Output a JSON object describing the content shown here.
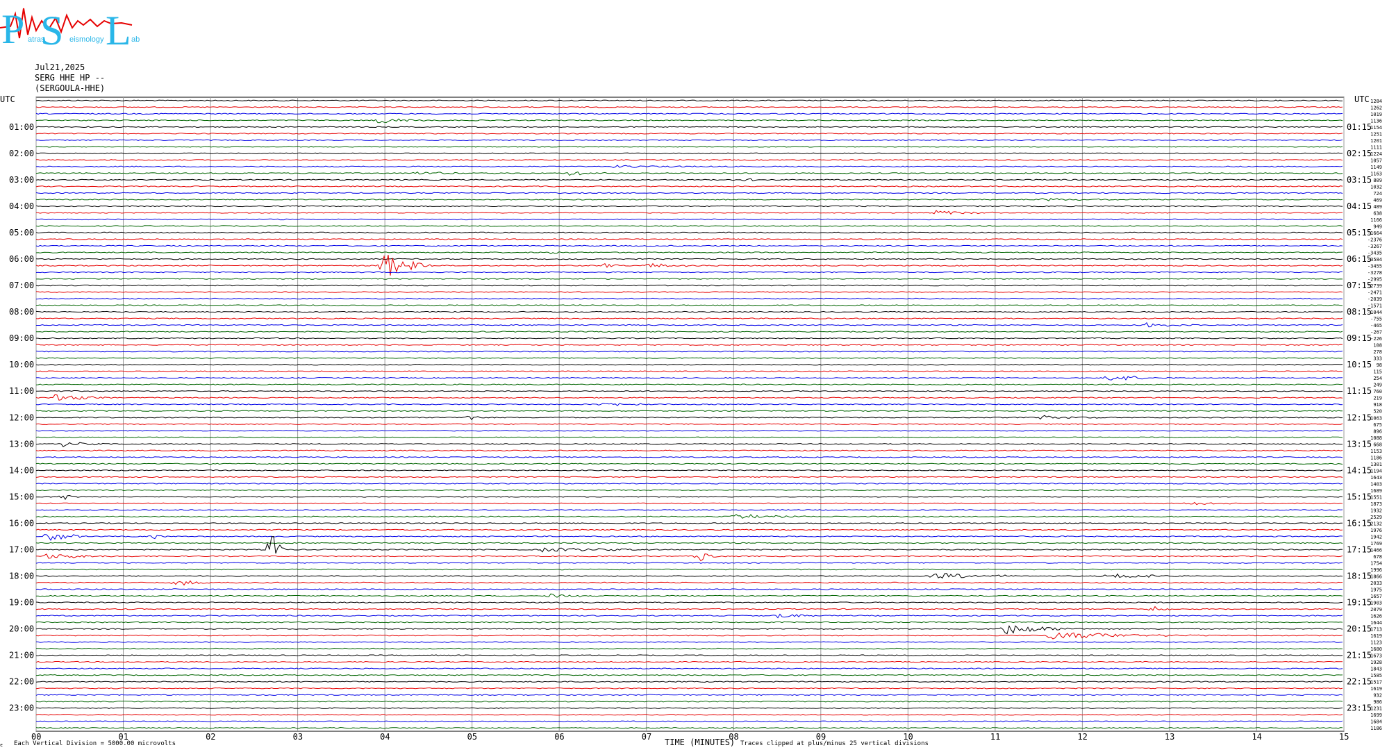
{
  "logo": {
    "letters": [
      "P",
      "S",
      "L"
    ],
    "subtext": [
      "atras",
      "eismology",
      "ab"
    ]
  },
  "header": {
    "date": "Jul21,2025",
    "station": "SERG HHE HP --",
    "channel": "(SERGOULA-HHE)"
  },
  "left_axis_label": "UTC",
  "right_axis_label": "UTC",
  "colors": {
    "black": "#000000",
    "red": "#e60000",
    "blue": "#0000e6",
    "green": "#006400",
    "grid": "#999999"
  },
  "footer": {
    "division": "Each Vertical Division = 5000.00 microvolts",
    "xlabel": "TIME (MINUTES)",
    "clip_note": "Traces clipped at plus/minus 25 vertical divisions",
    "corner_mark": "ϵ"
  },
  "chart_data": {
    "type": "helicorder",
    "x_ticks": [
      "00",
      "01",
      "02",
      "03",
      "04",
      "05",
      "06",
      "07",
      "08",
      "09",
      "10",
      "11",
      "12",
      "13",
      "14",
      "15"
    ],
    "xlim": [
      0,
      15
    ],
    "trace_colors": [
      "black",
      "red",
      "blue",
      "green"
    ],
    "left_hour_labels": [
      "01:00",
      "02:00",
      "03:00",
      "04:00",
      "05:00",
      "06:00",
      "07:00",
      "08:00",
      "09:00",
      "10:00",
      "11:00",
      "12:00",
      "13:00",
      "14:00",
      "15:00",
      "16:00",
      "17:00",
      "18:00",
      "19:00",
      "20:00",
      "21:00",
      "22:00",
      "23:00"
    ],
    "right_hour_labels": [
      "01:15",
      "02:15",
      "03:15",
      "04:15",
      "05:15",
      "06:15",
      "07:15",
      "08:15",
      "09:15",
      "10:15",
      "11:15",
      "12:15",
      "13:15",
      "14:15",
      "15:15",
      "16:15",
      "17:15",
      "18:15",
      "19:15",
      "20:15",
      "21:15",
      "22:15",
      "23:15"
    ],
    "trace_offsets": [
      1284,
      1262,
      1019,
      1136,
      1154,
      1251,
      1201,
      1111,
      1224,
      1057,
      1149,
      1163,
      809,
      1032,
      724,
      469,
      489,
      638,
      1166,
      949,
      -1664,
      -2376,
      -3267,
      -3435,
      -3584,
      -3455,
      -3278,
      -2995,
      -2739,
      -2471,
      -2039,
      -1571,
      -1044,
      -755,
      -465,
      -267,
      -226,
      108,
      278,
      333,
      98,
      115,
      254,
      249,
      760,
      219,
      918,
      520,
      1063,
      675,
      896,
      1088,
      668,
      1153,
      1186,
      1301,
      1194,
      1643,
      1403,
      1689,
      1551,
      1873,
      1932,
      2529,
      2132,
      1976,
      1942,
      1769,
      1466,
      678,
      1754,
      1996,
      1866,
      2033,
      1975,
      1657,
      1903,
      2079,
      1626,
      1644,
      1713,
      1619,
      1123,
      1680,
      1673,
      1928,
      1843,
      1585,
      1517,
      1619,
      932,
      986,
      1231,
      1699,
      1684,
      1186
    ],
    "events": [
      {
        "trace": 3,
        "minute": 3.9,
        "amp": 5,
        "dur": 0.6
      },
      {
        "trace": 11,
        "minute": 4.3,
        "amp": 2,
        "dur": 1.0
      },
      {
        "trace": 11,
        "minute": 6.1,
        "amp": 3,
        "dur": 1.0
      },
      {
        "trace": 10,
        "minute": 6.6,
        "amp": 2,
        "dur": 1.3
      },
      {
        "trace": 12,
        "minute": 8.15,
        "amp": 6,
        "dur": 0.15
      },
      {
        "trace": 15,
        "minute": 11.5,
        "amp": 2,
        "dur": 1.2
      },
      {
        "trace": 17,
        "minute": 10.3,
        "amp": 4,
        "dur": 0.8
      },
      {
        "trace": 23,
        "minute": 5.9,
        "amp": 4,
        "dur": 0.2
      },
      {
        "trace": 25,
        "minute": 3.95,
        "amp": 25,
        "dur": 0.6
      },
      {
        "trace": 25,
        "minute": 6.5,
        "amp": 4,
        "dur": 0.3
      },
      {
        "trace": 25,
        "minute": 7.0,
        "amp": 4,
        "dur": 0.6
      },
      {
        "trace": 31,
        "minute": 6.1,
        "amp": 2,
        "dur": 0.3
      },
      {
        "trace": 34,
        "minute": 12.7,
        "amp": 4,
        "dur": 0.6
      },
      {
        "trace": 42,
        "minute": 12.3,
        "amp": 5,
        "dur": 0.8
      },
      {
        "trace": 45,
        "minute": 0.2,
        "amp": 5,
        "dur": 0.8
      },
      {
        "trace": 46,
        "minute": 6.5,
        "amp": 4,
        "dur": 0.6
      },
      {
        "trace": 48,
        "minute": 4.95,
        "amp": 7,
        "dur": 0.2
      },
      {
        "trace": 48,
        "minute": 11.5,
        "amp": 3,
        "dur": 0.8
      },
      {
        "trace": 52,
        "minute": 0.3,
        "amp": 4,
        "dur": 0.5
      },
      {
        "trace": 60,
        "minute": 0.3,
        "amp": 5,
        "dur": 0.2
      },
      {
        "trace": 61,
        "minute": 13.2,
        "amp": 3,
        "dur": 0.8
      },
      {
        "trace": 63,
        "minute": 8.0,
        "amp": 4,
        "dur": 0.9
      },
      {
        "trace": 66,
        "minute": 0.1,
        "amp": 10,
        "dur": 0.5
      },
      {
        "trace": 66,
        "minute": 1.3,
        "amp": 5,
        "dur": 0.2
      },
      {
        "trace": 68,
        "minute": 2.7,
        "amp": 30,
        "dur": 0.15
      },
      {
        "trace": 68,
        "minute": 5.8,
        "amp": 3,
        "dur": 1.5
      },
      {
        "trace": 69,
        "minute": 0.1,
        "amp": 4,
        "dur": 1.0
      },
      {
        "trace": 69,
        "minute": 7.6,
        "amp": 10,
        "dur": 0.25
      },
      {
        "trace": 72,
        "minute": 10.3,
        "amp": 5,
        "dur": 1.0
      },
      {
        "trace": 72,
        "minute": 12.3,
        "amp": 4,
        "dur": 1.0
      },
      {
        "trace": 73,
        "minute": 1.6,
        "amp": 4,
        "dur": 0.6
      },
      {
        "trace": 75,
        "minute": 5.9,
        "amp": 4,
        "dur": 0.6
      },
      {
        "trace": 77,
        "minute": 12.8,
        "amp": 5,
        "dur": 0.4
      },
      {
        "trace": 78,
        "minute": 8.5,
        "amp": 4,
        "dur": 0.6
      },
      {
        "trace": 80,
        "minute": 11.1,
        "amp": 9,
        "dur": 0.9
      },
      {
        "trace": 81,
        "minute": 11.6,
        "amp": 6,
        "dur": 1.8
      }
    ],
    "xlabel": "TIME (MINUTES)"
  }
}
